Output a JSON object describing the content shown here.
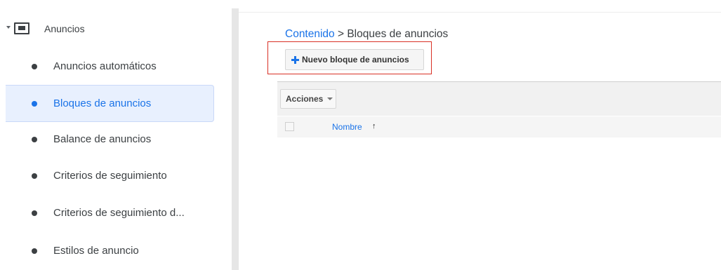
{
  "sidebar": {
    "section_label": "Anuncios",
    "items": [
      {
        "label": "Anuncios automáticos"
      },
      {
        "label": "Bloques de anuncios",
        "active": true
      },
      {
        "label": "Balance de anuncios"
      },
      {
        "label": "Criterios de seguimiento"
      },
      {
        "label": "Criterios de seguimiento d..."
      },
      {
        "label": "Estilos de anuncio"
      }
    ]
  },
  "breadcrumb": {
    "link": "Contenido",
    "separator": " > ",
    "current": "Bloques de anuncios"
  },
  "toolbar": {
    "new_button_label": "Nuevo bloque de anuncios",
    "actions_label": "Acciones"
  },
  "table": {
    "columns": [
      {
        "label": "Nombre",
        "sort": "ascending",
        "sort_glyph": "↑"
      }
    ]
  },
  "colors": {
    "accent": "#1a73e8",
    "highlight_border": "#d93025",
    "active_bg": "#e8f0fe"
  }
}
